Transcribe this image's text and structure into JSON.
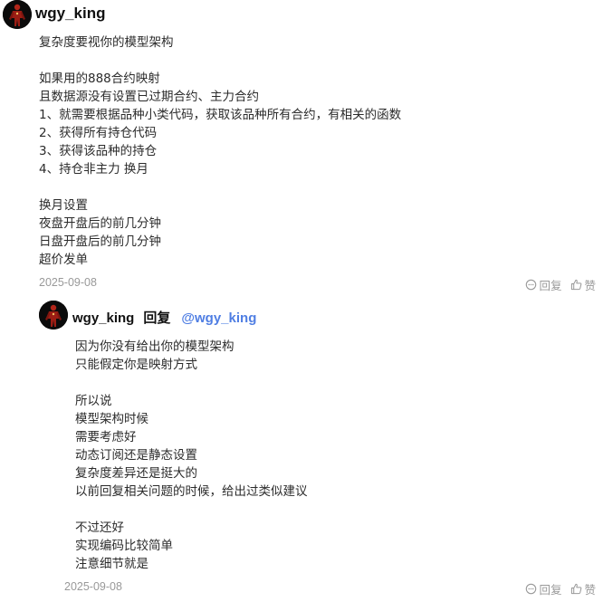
{
  "comment": {
    "author": "wgy_king",
    "lines": [
      "复杂度要视你的模型架构",
      "",
      "如果用的888合约映射",
      "且数据源没有设置已过期合约、主力合约",
      "1、就需要根据品种小类代码，获取该品种所有合约，有相关的函数",
      "2、获得所有持仓代码",
      "3、获得该品种的持仓",
      "4、持仓非主力 换月",
      "",
      "换月设置",
      "夜盘开盘后的前几分钟",
      "日盘开盘后的前几分钟",
      "超价发单"
    ],
    "date": "2025-09-08",
    "reply_label": "回复",
    "like_label": "赞"
  },
  "reply": {
    "author": "wgy_king",
    "reply_word": "回复",
    "mention": "@wgy_king",
    "lines": [
      "因为你没有给出你的模型架构",
      "只能假定你是映射方式",
      "",
      "所以说",
      "模型架构时候",
      "需要考虑好",
      "动态订阅还是静态设置",
      "复杂度差异还是挺大的",
      "以前回复相关问题的时候，给出过类似建议",
      "",
      "不过还好",
      "实现编码比较简单",
      "注意细节就是"
    ],
    "date": "2025-09-08",
    "reply_label": "回复",
    "like_label": "赞"
  },
  "colors": {
    "mention": "#4f7ee3",
    "meta": "#999999",
    "avatar_bg": "#0b0b0b",
    "avatar_figure": "#9b1d14"
  }
}
